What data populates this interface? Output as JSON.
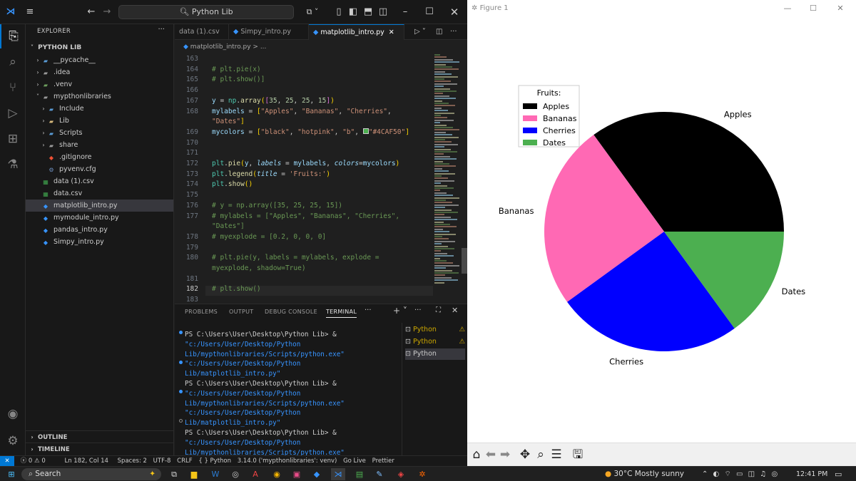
{
  "titlebar": {
    "search": "Python Lib"
  },
  "sidebar": {
    "header": "EXPLORER",
    "folder": "PYTHON LIB",
    "items": [
      {
        "label": "__pycache__"
      },
      {
        "label": ".idea"
      },
      {
        "label": ".venv"
      },
      {
        "label": "mypthonlibraries"
      },
      {
        "label": "Include"
      },
      {
        "label": "Lib"
      },
      {
        "label": "Scripts"
      },
      {
        "label": "share"
      },
      {
        "label": ".gitignore"
      },
      {
        "label": "pyvenv.cfg"
      },
      {
        "label": "data (1).csv"
      },
      {
        "label": "data.csv"
      },
      {
        "label": "matplotlib_intro.py"
      },
      {
        "label": "mymodule_intro.py"
      },
      {
        "label": "pandas_intro.py"
      },
      {
        "label": "Simpy_intro.py"
      }
    ],
    "outline": "OUTLINE",
    "timeline": "TIMELINE"
  },
  "editor": {
    "tabs": [
      {
        "label": "data (1).csv"
      },
      {
        "label": "Simpy_intro.py"
      },
      {
        "label": "matplotlib_intro.py"
      }
    ],
    "breadcrumb": "matplotlib_intro.py > ...",
    "line_numbers": [
      "163",
      "164",
      "165",
      "166",
      "167",
      "168",
      "",
      "169",
      "170",
      "171",
      "172",
      "173",
      "174",
      "175",
      "176",
      "177",
      "",
      "178",
      "179",
      "180",
      "",
      "181",
      "182",
      "183"
    ]
  },
  "panel": {
    "tabs": [
      "PROBLEMS",
      "OUTPUT",
      "DEBUG CONSOLE",
      "TERMINAL"
    ],
    "active_tab": "TERMINAL",
    "terminal_lines": [
      {
        "prompt": "PS C:\\Users\\User\\Desktop\\Python Lib> & ",
        "path": "\"c:/Users/User/Desktop/Python Lib/mypthonlibraries/Scripts/python.exe\" \"c:/Users/User/Desktop/Python Lib/matplotlib_intro.py\""
      },
      {
        "prompt": "PS C:\\Users\\User\\Desktop\\Python Lib> & ",
        "path": "\"c:/Users/User/Desktop/Python Lib/mypthonlibraries/Scripts/python.exe\" \"c:/Users/User/Desktop/Python Lib/matplotlib_intro.py\""
      },
      {
        "prompt": "PS C:\\Users\\User\\Desktop\\Python Lib> & ",
        "path": "\"c:/Users/User/Desktop/Python Lib/mypthonlibraries/Scripts/python.exe\" \"c:/Users/User/Desktop/Python Lib/matplotlib_intro.py\""
      }
    ],
    "terminals": [
      {
        "label": "Python"
      },
      {
        "label": "Python"
      },
      {
        "label": "Python"
      }
    ]
  },
  "statusbar": {
    "errors": "0",
    "warnings": "0",
    "position": "Ln 182, Col 14",
    "spaces": "Spaces: 2",
    "encoding": "UTF-8",
    "eol": "CRLF",
    "language": "{ } Python",
    "interpreter": "3.14.0 ('mypthonlibraries': venv)",
    "golive": "Go Live",
    "prettier": "Prettier"
  },
  "figure": {
    "title": "Figure 1"
  },
  "chart_data": {
    "type": "pie",
    "categories": [
      "Apples",
      "Bananas",
      "Cherries",
      "Dates"
    ],
    "values": [
      35,
      25,
      25,
      15
    ],
    "colors": [
      "#000000",
      "#ff69b4",
      "#0000ff",
      "#4CAF50"
    ],
    "legend_title": "Fruits:",
    "legend_placement": "top-left",
    "start_angle": 0
  },
  "taskbar": {
    "search": "Search",
    "weather": "30°C  Mostly sunny",
    "time": "12:41 PM"
  }
}
